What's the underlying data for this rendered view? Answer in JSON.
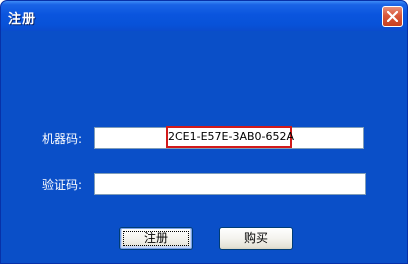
{
  "window": {
    "title": "注册",
    "close_icon": "close-icon"
  },
  "form": {
    "machine_code_label": "机器码:",
    "machine_code_value": "2CE1-E57E-3AB0-652A",
    "verify_code_label": "验证码:",
    "verify_code_value": ""
  },
  "buttons": {
    "register_label": "注册",
    "buy_label": "购买"
  },
  "colors": {
    "client_background": "#0a4fc8",
    "title_bar": "#0852d8",
    "close_button": "#d9573a",
    "highlight_border": "#d11a1a"
  }
}
